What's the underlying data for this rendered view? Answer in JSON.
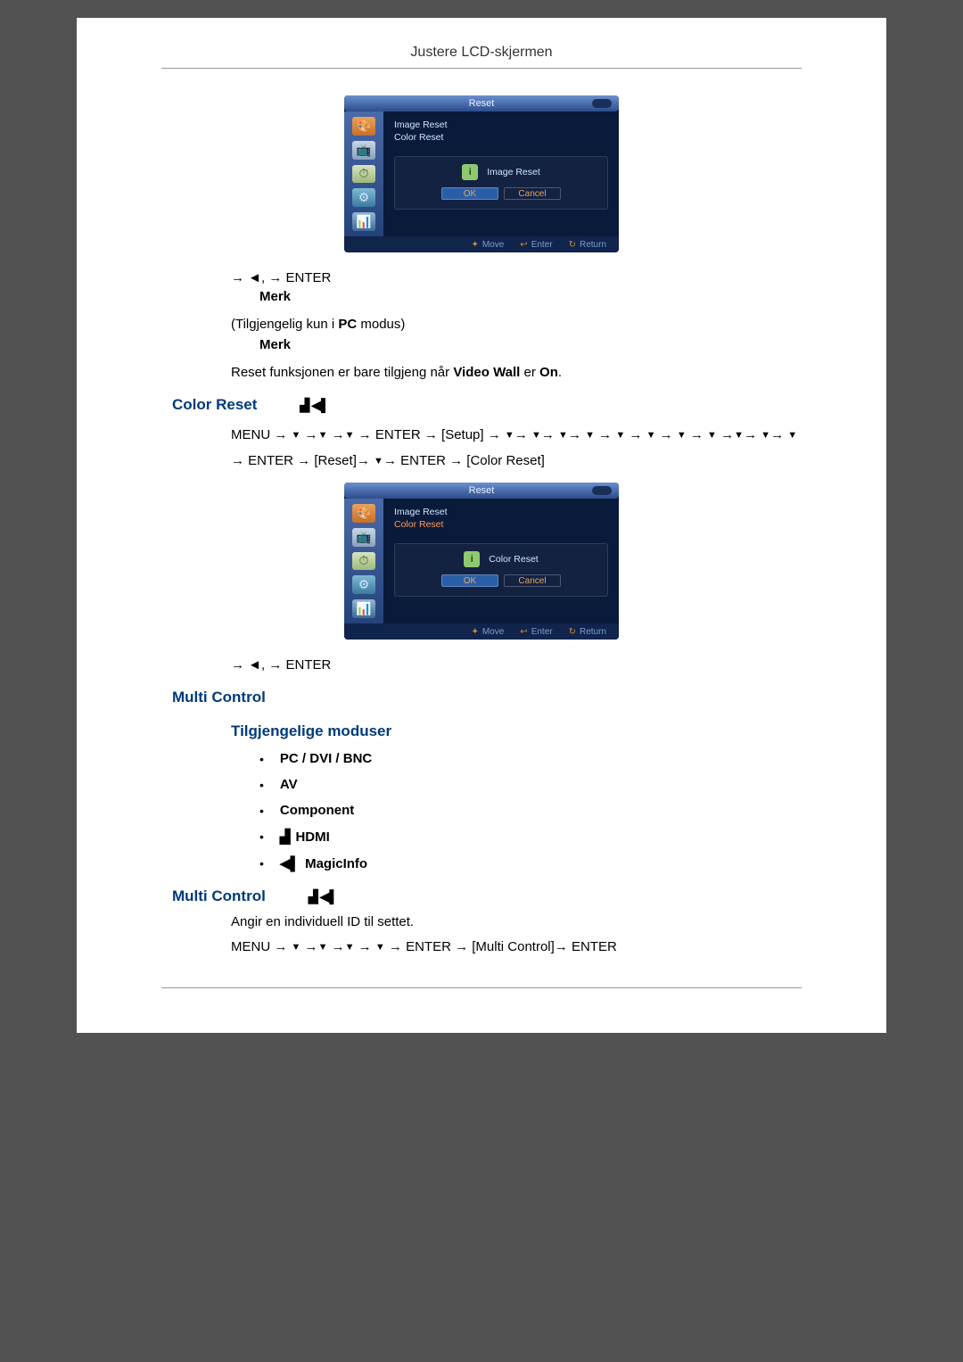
{
  "header": {
    "title": "Justere LCD-skjermen"
  },
  "osd1": {
    "title": "Reset",
    "items": [
      "Image Reset",
      "Color Reset"
    ],
    "active_index": 0,
    "dialog_title": "Image Reset",
    "btn_ok": "OK",
    "btn_cancel": "Cancel",
    "foot_move": "Move",
    "foot_enter": "Enter",
    "foot_return": "Return"
  },
  "nav1": "→ ◄,   → ENTER",
  "note_label": "Merk",
  "body1_pre": "(Tilgjengelig kun i ",
  "body1_bold": "PC",
  "body1_post": " modus)",
  "body2_pre": "Reset funksjonen er bare tilgjeng når ",
  "body2_b1": "Video Wall",
  "body2_mid": " er ",
  "body2_b2": "On",
  "body2_post": ".",
  "section_color_reset": "Color Reset",
  "menu_path1": {
    "parts": [
      "MENU → ",
      "▼",
      " →",
      "▼",
      " →",
      "▼",
      " → ENTER → ",
      "[Setup]",
      " → ",
      "▼",
      "→ ",
      "▼",
      "→ ",
      "▼",
      "→ ",
      "▼",
      " → ",
      "▼",
      " → ",
      "▼",
      " → ",
      "▼",
      " → ",
      "▼",
      " →",
      "▼",
      "→ ",
      "▼",
      "→ ",
      "▼",
      " → ENTER → ",
      "[Reset]",
      "→ ",
      "▼",
      "→ ENTER → ",
      "[Color Reset]"
    ]
  },
  "osd2": {
    "title": "Reset",
    "items": [
      "Image Reset",
      "Color Reset"
    ],
    "active_index": 1,
    "dialog_title": "Color Reset",
    "btn_ok": "OK",
    "btn_cancel": "Cancel",
    "foot_move": "Move",
    "foot_enter": "Enter",
    "foot_return": "Return"
  },
  "nav2": "→ ◄,   → ENTER",
  "section_multi_control": "Multi Control",
  "section_modes": "Tilgjengelige moduser",
  "modes": {
    "pc": "PC / DVI / BNC",
    "av": "AV",
    "component": "Component",
    "hdmi": "HDMI",
    "magicinfo": "MagicInfo"
  },
  "section_multi_control2": "Multi Control",
  "body3": "Angir en individuell ID til settet.",
  "menu_path2": {
    "parts": [
      "MENU → ",
      "▼",
      " →",
      "▼",
      " →",
      "▼",
      " → ",
      "▼",
      " → ENTER → ",
      "[Multi Control]",
      "→ ENTER"
    ]
  }
}
